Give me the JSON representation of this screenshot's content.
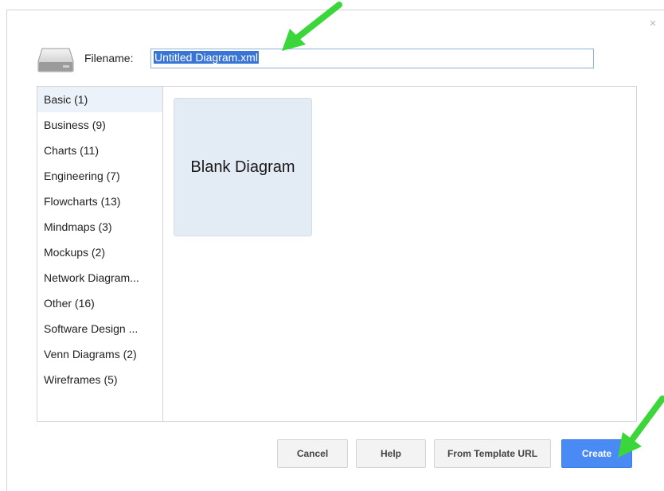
{
  "dialog": {
    "close_symbol": "×",
    "filename_label": "Filename:",
    "filename_value": "Untitled Diagram.xml"
  },
  "categories": [
    {
      "label": "Basic (1)"
    },
    {
      "label": "Business (9)"
    },
    {
      "label": "Charts (11)"
    },
    {
      "label": "Engineering (7)"
    },
    {
      "label": "Flowcharts (13)"
    },
    {
      "label": "Mindmaps (3)"
    },
    {
      "label": "Mockups (2)"
    },
    {
      "label": "Network Diagram..."
    },
    {
      "label": "Other (16)"
    },
    {
      "label": "Software Design ..."
    },
    {
      "label": "Venn Diagrams (2)"
    },
    {
      "label": "Wireframes (5)"
    }
  ],
  "selected_category": "Basic (1)",
  "templates": [
    {
      "label": "Blank Diagram"
    }
  ],
  "buttons": {
    "cancel": "Cancel",
    "help": "Help",
    "from_template_url": "From Template URL",
    "create": "Create"
  },
  "icons": {
    "drive": "drive-icon",
    "close": "close-icon",
    "annotation_arrow": "green-arrow-icon"
  },
  "colors": {
    "accent": "#4a8af4",
    "selection": "#3875d7",
    "selected_category_bg": "#ebf2f9",
    "template_tile_bg": "#e3ebf5",
    "annotation_arrow": "#3ad63a"
  }
}
